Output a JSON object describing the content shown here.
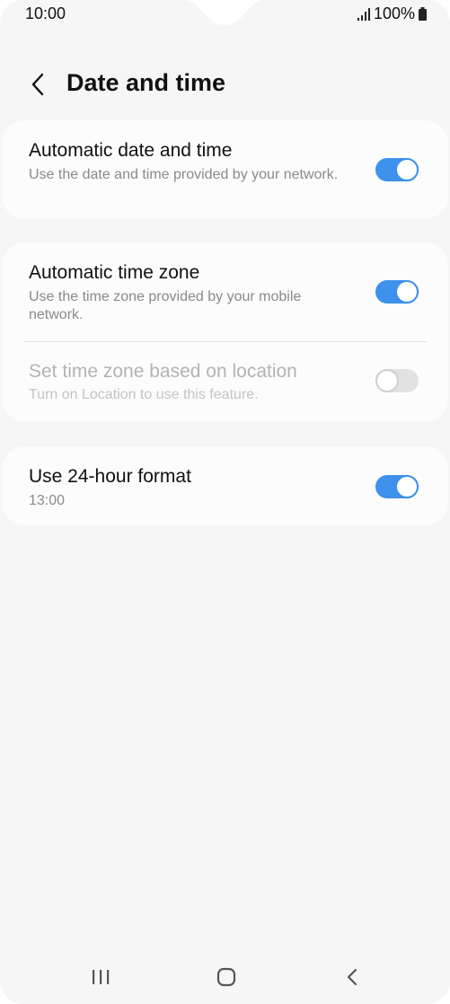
{
  "status_bar": {
    "time": "10:00",
    "battery": "100%",
    "signal_icon": "signal-bars-icon",
    "battery_icon": "battery-full-icon"
  },
  "header": {
    "title": "Date and time",
    "back_icon": "chevron-left-icon"
  },
  "settings": {
    "auto_date_time": {
      "title": "Automatic date and time",
      "subtitle": "Use the date and time provided by your network.",
      "enabled": true
    },
    "auto_time_zone": {
      "title": "Automatic time zone",
      "subtitle": "Use the time zone provided by your mobile network.",
      "enabled": true
    },
    "location_time_zone": {
      "title": "Set time zone based on location",
      "subtitle": "Turn on Location to use this feature.",
      "enabled": false,
      "disabled": true
    },
    "format_24_hour": {
      "title": "Use 24-hour format",
      "subtitle": "13:00",
      "enabled": true
    }
  },
  "nav_bar": {
    "recents_icon": "recents-icon",
    "home_icon": "home-icon",
    "back_icon": "back-icon"
  },
  "colors": {
    "accent": "#3e91ec",
    "background": "#f6f6f6",
    "card": "#fcfcfc"
  }
}
